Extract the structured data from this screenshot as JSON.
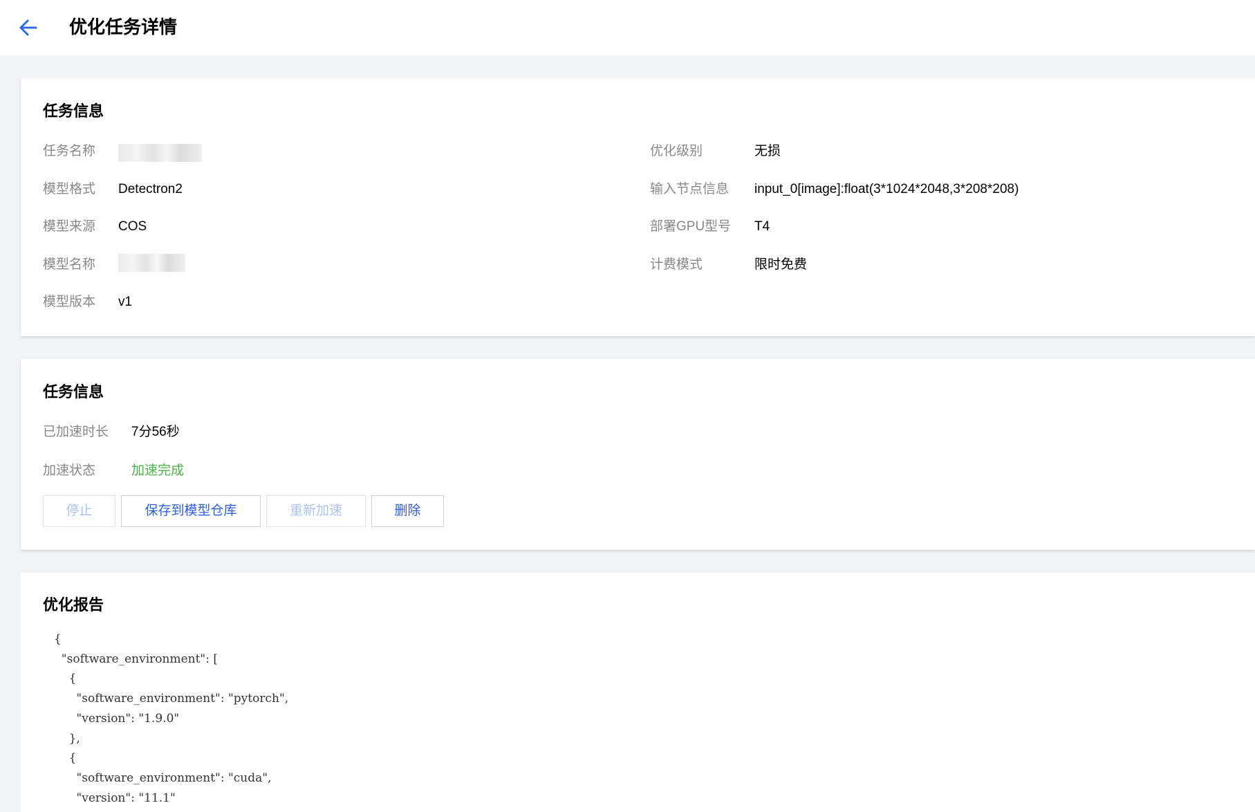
{
  "header": {
    "back_icon": "arrow-left-icon",
    "title": "优化任务详情",
    "accent_color": "#2d6be4"
  },
  "task_info": {
    "title": "任务信息",
    "left": [
      {
        "label": "任务名称",
        "value": "",
        "redacted": true
      },
      {
        "label": "模型格式",
        "value": "Detectron2"
      },
      {
        "label": "模型来源",
        "value": "COS"
      },
      {
        "label": "模型名称",
        "value": "",
        "redacted": true
      },
      {
        "label": "模型版本",
        "value": "v1"
      }
    ],
    "right": [
      {
        "label": "优化级别",
        "value": "无损"
      },
      {
        "label": "输入节点信息",
        "value": "input_0[image]:float(3*1024*2048,3*208*208)"
      },
      {
        "label": "部署GPU型号",
        "value": "T4"
      },
      {
        "label": "计费模式",
        "value": "限时免费"
      }
    ]
  },
  "acceleration": {
    "title": "任务信息",
    "duration_label": "已加速时长",
    "duration_value": "7分56秒",
    "status_label": "加速状态",
    "status_value": "加速完成",
    "status_color": "#4cb347",
    "buttons": {
      "stop": "停止",
      "save": "保存到模型仓库",
      "restart": "重新加速",
      "delete": "删除"
    }
  },
  "report": {
    "title": "优化报告",
    "code": "{\n  \"software_environment\": [\n    {\n      \"software_environment\": \"pytorch\",\n      \"version\": \"1.9.0\"\n    },\n    {\n      \"software_environment\": \"cuda\",\n      \"version\": \"11.1\""
  }
}
